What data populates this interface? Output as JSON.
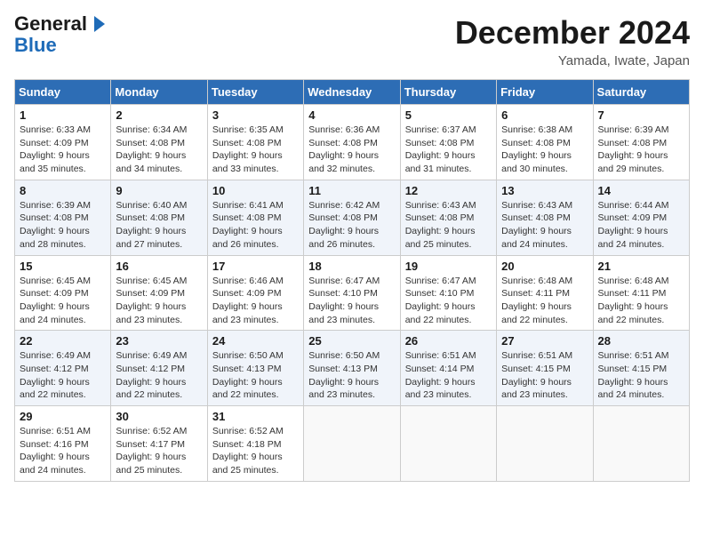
{
  "header": {
    "logo_line1": "General",
    "logo_line2": "Blue",
    "month_title": "December 2024",
    "location": "Yamada, Iwate, Japan"
  },
  "columns": [
    "Sunday",
    "Monday",
    "Tuesday",
    "Wednesday",
    "Thursday",
    "Friday",
    "Saturday"
  ],
  "weeks": [
    [
      {
        "day": "1",
        "sunrise": "Sunrise: 6:33 AM",
        "sunset": "Sunset: 4:09 PM",
        "daylight": "Daylight: 9 hours and 35 minutes."
      },
      {
        "day": "2",
        "sunrise": "Sunrise: 6:34 AM",
        "sunset": "Sunset: 4:08 PM",
        "daylight": "Daylight: 9 hours and 34 minutes."
      },
      {
        "day": "3",
        "sunrise": "Sunrise: 6:35 AM",
        "sunset": "Sunset: 4:08 PM",
        "daylight": "Daylight: 9 hours and 33 minutes."
      },
      {
        "day": "4",
        "sunrise": "Sunrise: 6:36 AM",
        "sunset": "Sunset: 4:08 PM",
        "daylight": "Daylight: 9 hours and 32 minutes."
      },
      {
        "day": "5",
        "sunrise": "Sunrise: 6:37 AM",
        "sunset": "Sunset: 4:08 PM",
        "daylight": "Daylight: 9 hours and 31 minutes."
      },
      {
        "day": "6",
        "sunrise": "Sunrise: 6:38 AM",
        "sunset": "Sunset: 4:08 PM",
        "daylight": "Daylight: 9 hours and 30 minutes."
      },
      {
        "day": "7",
        "sunrise": "Sunrise: 6:39 AM",
        "sunset": "Sunset: 4:08 PM",
        "daylight": "Daylight: 9 hours and 29 minutes."
      }
    ],
    [
      {
        "day": "8",
        "sunrise": "Sunrise: 6:39 AM",
        "sunset": "Sunset: 4:08 PM",
        "daylight": "Daylight: 9 hours and 28 minutes."
      },
      {
        "day": "9",
        "sunrise": "Sunrise: 6:40 AM",
        "sunset": "Sunset: 4:08 PM",
        "daylight": "Daylight: 9 hours and 27 minutes."
      },
      {
        "day": "10",
        "sunrise": "Sunrise: 6:41 AM",
        "sunset": "Sunset: 4:08 PM",
        "daylight": "Daylight: 9 hours and 26 minutes."
      },
      {
        "day": "11",
        "sunrise": "Sunrise: 6:42 AM",
        "sunset": "Sunset: 4:08 PM",
        "daylight": "Daylight: 9 hours and 26 minutes."
      },
      {
        "day": "12",
        "sunrise": "Sunrise: 6:43 AM",
        "sunset": "Sunset: 4:08 PM",
        "daylight": "Daylight: 9 hours and 25 minutes."
      },
      {
        "day": "13",
        "sunrise": "Sunrise: 6:43 AM",
        "sunset": "Sunset: 4:08 PM",
        "daylight": "Daylight: 9 hours and 24 minutes."
      },
      {
        "day": "14",
        "sunrise": "Sunrise: 6:44 AM",
        "sunset": "Sunset: 4:09 PM",
        "daylight": "Daylight: 9 hours and 24 minutes."
      }
    ],
    [
      {
        "day": "15",
        "sunrise": "Sunrise: 6:45 AM",
        "sunset": "Sunset: 4:09 PM",
        "daylight": "Daylight: 9 hours and 24 minutes."
      },
      {
        "day": "16",
        "sunrise": "Sunrise: 6:45 AM",
        "sunset": "Sunset: 4:09 PM",
        "daylight": "Daylight: 9 hours and 23 minutes."
      },
      {
        "day": "17",
        "sunrise": "Sunrise: 6:46 AM",
        "sunset": "Sunset: 4:09 PM",
        "daylight": "Daylight: 9 hours and 23 minutes."
      },
      {
        "day": "18",
        "sunrise": "Sunrise: 6:47 AM",
        "sunset": "Sunset: 4:10 PM",
        "daylight": "Daylight: 9 hours and 23 minutes."
      },
      {
        "day": "19",
        "sunrise": "Sunrise: 6:47 AM",
        "sunset": "Sunset: 4:10 PM",
        "daylight": "Daylight: 9 hours and 22 minutes."
      },
      {
        "day": "20",
        "sunrise": "Sunrise: 6:48 AM",
        "sunset": "Sunset: 4:11 PM",
        "daylight": "Daylight: 9 hours and 22 minutes."
      },
      {
        "day": "21",
        "sunrise": "Sunrise: 6:48 AM",
        "sunset": "Sunset: 4:11 PM",
        "daylight": "Daylight: 9 hours and 22 minutes."
      }
    ],
    [
      {
        "day": "22",
        "sunrise": "Sunrise: 6:49 AM",
        "sunset": "Sunset: 4:12 PM",
        "daylight": "Daylight: 9 hours and 22 minutes."
      },
      {
        "day": "23",
        "sunrise": "Sunrise: 6:49 AM",
        "sunset": "Sunset: 4:12 PM",
        "daylight": "Daylight: 9 hours and 22 minutes."
      },
      {
        "day": "24",
        "sunrise": "Sunrise: 6:50 AM",
        "sunset": "Sunset: 4:13 PM",
        "daylight": "Daylight: 9 hours and 22 minutes."
      },
      {
        "day": "25",
        "sunrise": "Sunrise: 6:50 AM",
        "sunset": "Sunset: 4:13 PM",
        "daylight": "Daylight: 9 hours and 23 minutes."
      },
      {
        "day": "26",
        "sunrise": "Sunrise: 6:51 AM",
        "sunset": "Sunset: 4:14 PM",
        "daylight": "Daylight: 9 hours and 23 minutes."
      },
      {
        "day": "27",
        "sunrise": "Sunrise: 6:51 AM",
        "sunset": "Sunset: 4:15 PM",
        "daylight": "Daylight: 9 hours and 23 minutes."
      },
      {
        "day": "28",
        "sunrise": "Sunrise: 6:51 AM",
        "sunset": "Sunset: 4:15 PM",
        "daylight": "Daylight: 9 hours and 24 minutes."
      }
    ],
    [
      {
        "day": "29",
        "sunrise": "Sunrise: 6:51 AM",
        "sunset": "Sunset: 4:16 PM",
        "daylight": "Daylight: 9 hours and 24 minutes."
      },
      {
        "day": "30",
        "sunrise": "Sunrise: 6:52 AM",
        "sunset": "Sunset: 4:17 PM",
        "daylight": "Daylight: 9 hours and 25 minutes."
      },
      {
        "day": "31",
        "sunrise": "Sunrise: 6:52 AM",
        "sunset": "Sunset: 4:18 PM",
        "daylight": "Daylight: 9 hours and 25 minutes."
      },
      null,
      null,
      null,
      null
    ]
  ]
}
